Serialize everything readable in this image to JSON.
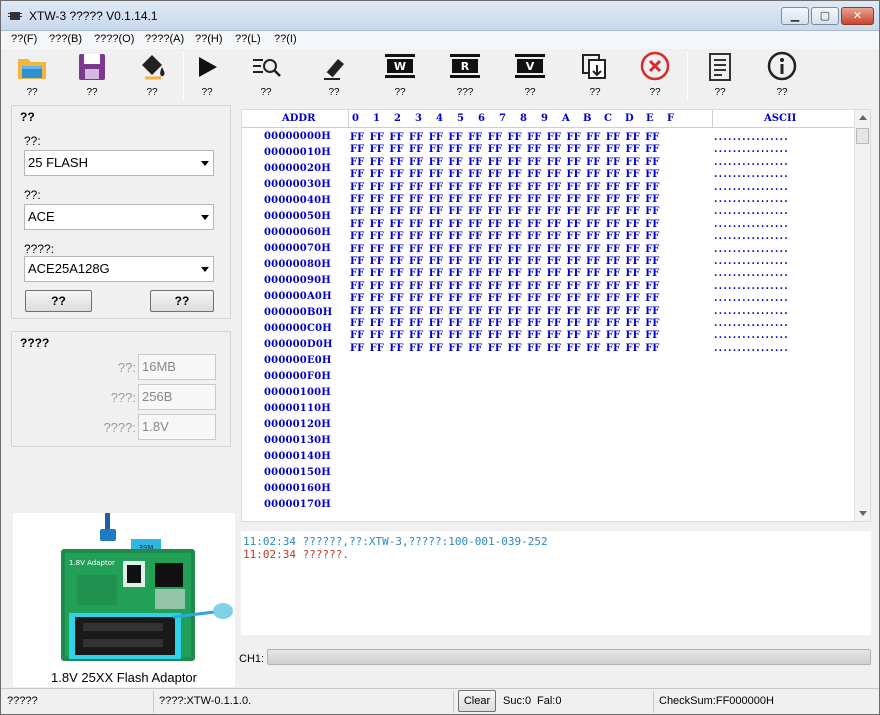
{
  "window": {
    "title": "XTW-3 ?????  V0.1.14.1",
    "min": "▁",
    "max": "▢",
    "close": "✕"
  },
  "menu": [
    {
      "label": "??(F)"
    },
    {
      "label": "???(B)"
    },
    {
      "label": "????(O)"
    },
    {
      "label": "????(A)"
    },
    {
      "label": "??(H)"
    },
    {
      "label": "??(L)"
    },
    {
      "label": "??(I)"
    }
  ],
  "toolbar": [
    {
      "icon": "open-folder-icon",
      "label": "??"
    },
    {
      "icon": "save-icon",
      "label": "??"
    },
    {
      "icon": "fill-icon",
      "label": "??"
    },
    {
      "icon": "play-icon",
      "label": "??"
    },
    {
      "icon": "detect-icon",
      "label": "??"
    },
    {
      "icon": "erase-icon",
      "label": "??"
    },
    {
      "icon": "write-chip-icon",
      "label": "??",
      "letter": "W"
    },
    {
      "icon": "read-chip-icon",
      "label": "???",
      "letter": "R"
    },
    {
      "icon": "verify-chip-icon",
      "label": "??",
      "letter": "V"
    },
    {
      "icon": "copy-icon",
      "label": "??"
    },
    {
      "icon": "stop-icon",
      "label": "??"
    },
    {
      "icon": "document-icon",
      "label": "??"
    },
    {
      "icon": "info-icon",
      "label": "??"
    }
  ],
  "chip_group": {
    "title": "??",
    "type_label": "??:",
    "type_value": "25 FLASH",
    "maker_label": "??:",
    "maker_value": "ACE",
    "model_label": "????:",
    "model_value": "ACE25A128G",
    "button1": "??",
    "button2": "??"
  },
  "info_group": {
    "title": "????",
    "size_label": "??:",
    "size_value": "16MB",
    "page_label": "???:",
    "page_value": "256B",
    "voltage_label": "????:",
    "voltage_value": "1.8V"
  },
  "adaptor": {
    "caption": "1.8V 25XX Flash Adaptor",
    "board_text": "1.8V Adaptor",
    "tag_text": "39M"
  },
  "hex": {
    "addr_header": "ADDR",
    "col_headers": [
      "0",
      "1",
      "2",
      "3",
      "4",
      "5",
      "6",
      "7",
      "8",
      "9",
      "A",
      "B",
      "C",
      "D",
      "E",
      "F"
    ],
    "ascii_header": "ASCII",
    "rows": [
      {
        "addr": "00000000H",
        "bytes": "FF FF FF FF FF FF FF FF FF FF FF FF FF FF FF FF",
        "ascii": "................"
      },
      {
        "addr": "00000010H",
        "bytes": "FF FF FF FF FF FF FF FF FF FF FF FF FF FF FF FF",
        "ascii": "................"
      },
      {
        "addr": "00000020H",
        "bytes": "FF FF FF FF FF FF FF FF FF FF FF FF FF FF FF FF",
        "ascii": "................"
      },
      {
        "addr": "00000030H",
        "bytes": "FF FF FF FF FF FF FF FF FF FF FF FF FF FF FF FF",
        "ascii": "................"
      },
      {
        "addr": "00000040H",
        "bytes": "FF FF FF FF FF FF FF FF FF FF FF FF FF FF FF FF",
        "ascii": "................"
      },
      {
        "addr": "00000050H",
        "bytes": "FF FF FF FF FF FF FF FF FF FF FF FF FF FF FF FF",
        "ascii": "................"
      },
      {
        "addr": "00000060H",
        "bytes": "FF FF FF FF FF FF FF FF FF FF FF FF FF FF FF FF",
        "ascii": "................"
      },
      {
        "addr": "00000070H",
        "bytes": "FF FF FF FF FF FF FF FF FF FF FF FF FF FF FF FF",
        "ascii": "................"
      },
      {
        "addr": "00000080H",
        "bytes": "FF FF FF FF FF FF FF FF FF FF FF FF FF FF FF FF",
        "ascii": "................"
      },
      {
        "addr": "00000090H",
        "bytes": "FF FF FF FF FF FF FF FF FF FF FF FF FF FF FF FF",
        "ascii": "................"
      },
      {
        "addr": "000000A0H",
        "bytes": "FF FF FF FF FF FF FF FF FF FF FF FF FF FF FF FF",
        "ascii": "................"
      },
      {
        "addr": "000000B0H",
        "bytes": "FF FF FF FF FF FF FF FF FF FF FF FF FF FF FF FF",
        "ascii": "................"
      },
      {
        "addr": "000000C0H",
        "bytes": "FF FF FF FF FF FF FF FF FF FF FF FF FF FF FF FF",
        "ascii": "................"
      },
      {
        "addr": "000000D0H",
        "bytes": "FF FF FF FF FF FF FF FF FF FF FF FF FF FF FF FF",
        "ascii": "................"
      },
      {
        "addr": "000000E0H",
        "bytes": "FF FF FF FF FF FF FF FF FF FF FF FF FF FF FF FF",
        "ascii": "................"
      },
      {
        "addr": "000000F0H",
        "bytes": "FF FF FF FF FF FF FF FF FF FF FF FF FF FF FF FF",
        "ascii": "................"
      },
      {
        "addr": "00000100H",
        "bytes": "FF FF FF FF FF FF FF FF FF FF FF FF FF FF FF FF",
        "ascii": "................"
      },
      {
        "addr": "00000110H",
        "bytes": "FF FF FF FF FF FF FF FF FF FF FF FF FF FF FF FF",
        "ascii": "................"
      },
      {
        "addr": "00000120H",
        "bytes": "",
        "ascii": ""
      },
      {
        "addr": "00000130H",
        "bytes": "",
        "ascii": ""
      },
      {
        "addr": "00000140H",
        "bytes": "",
        "ascii": ""
      },
      {
        "addr": "00000150H",
        "bytes": "",
        "ascii": ""
      },
      {
        "addr": "00000160H",
        "bytes": "",
        "ascii": ""
      },
      {
        "addr": "00000170H",
        "bytes": "",
        "ascii": ""
      }
    ]
  },
  "log": [
    {
      "text": "11:02:34 ??????,??:XTW-3,?????:100-001-039-252",
      "color": "#2e86c1"
    },
    {
      "text": "11:02:34 ??????.",
      "color": "#c0392b"
    }
  ],
  "ch1": {
    "label": "CH1:",
    "progress": 0
  },
  "status": {
    "left": "?????",
    "version": "????:XTW-0.1.1.0.",
    "clear": "Clear",
    "suc": "Suc:0",
    "fal": "Fal:0",
    "checksum": "CheckSum:FF000000H"
  }
}
